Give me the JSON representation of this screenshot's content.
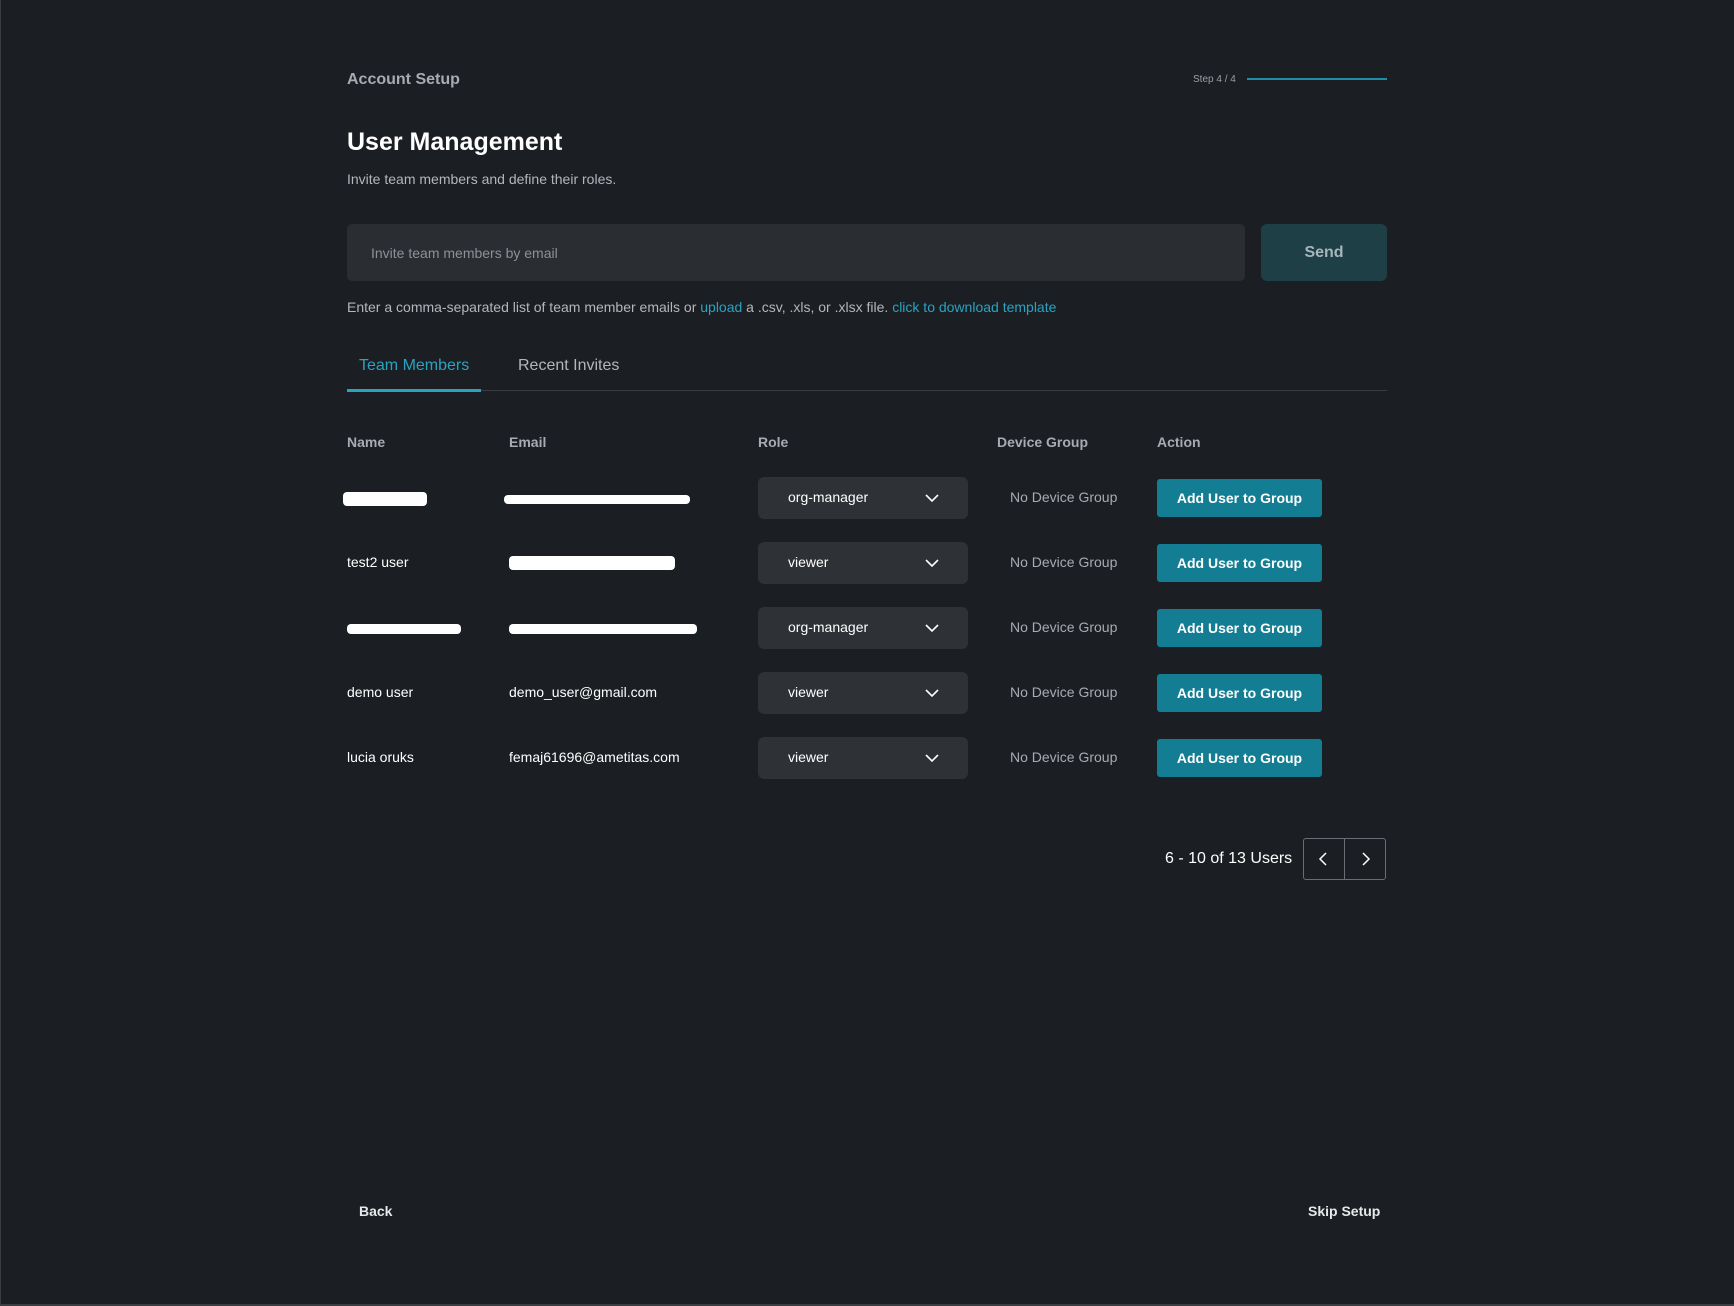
{
  "header": {
    "breadcrumb": "Account Setup",
    "step": "Step 4 / 4"
  },
  "page": {
    "title": "User Management",
    "subtitle": "Invite team members and define their roles."
  },
  "invite": {
    "placeholder": "Invite team members by email",
    "value": "",
    "send_label": "Send",
    "hint_prefix": "Enter a comma-separated list of team member emails or ",
    "hint_upload": "upload",
    "hint_middle": " a .csv, .xls, or .xlsx file. ",
    "hint_template": "click to download template"
  },
  "tabs": [
    {
      "label": "Team Members",
      "active": true
    },
    {
      "label": "Recent Invites",
      "active": false
    }
  ],
  "table": {
    "headers": {
      "name": "Name",
      "email": "Email",
      "role": "Role",
      "device_group": "Device Group",
      "action": "Action"
    },
    "rows": [
      {
        "name": "",
        "email": "",
        "role": "org-manager",
        "device_group": "No Device Group",
        "action": "Add User to Group"
      },
      {
        "name": "test2 user",
        "email": "",
        "role": "viewer",
        "device_group": "No Device Group",
        "action": "Add User to Group"
      },
      {
        "name": "",
        "email": "",
        "role": "org-manager",
        "device_group": "No Device Group",
        "action": "Add User to Group"
      },
      {
        "name": "demo user",
        "email": "demo_user@gmail.com",
        "role": "viewer",
        "device_group": "No Device Group",
        "action": "Add User to Group"
      },
      {
        "name": "lucia oruks",
        "email": "femaj61696@ametitas.com",
        "role": "viewer",
        "device_group": "No Device Group",
        "action": "Add User to Group"
      }
    ]
  },
  "pagination": {
    "text": "6 - 10 of 13 Users"
  },
  "footer": {
    "back_label": "Back",
    "skip_label": "Skip Setup"
  },
  "colors": {
    "accent": "#2aa3c2",
    "button": "#137e93",
    "background": "#1b1e22"
  }
}
